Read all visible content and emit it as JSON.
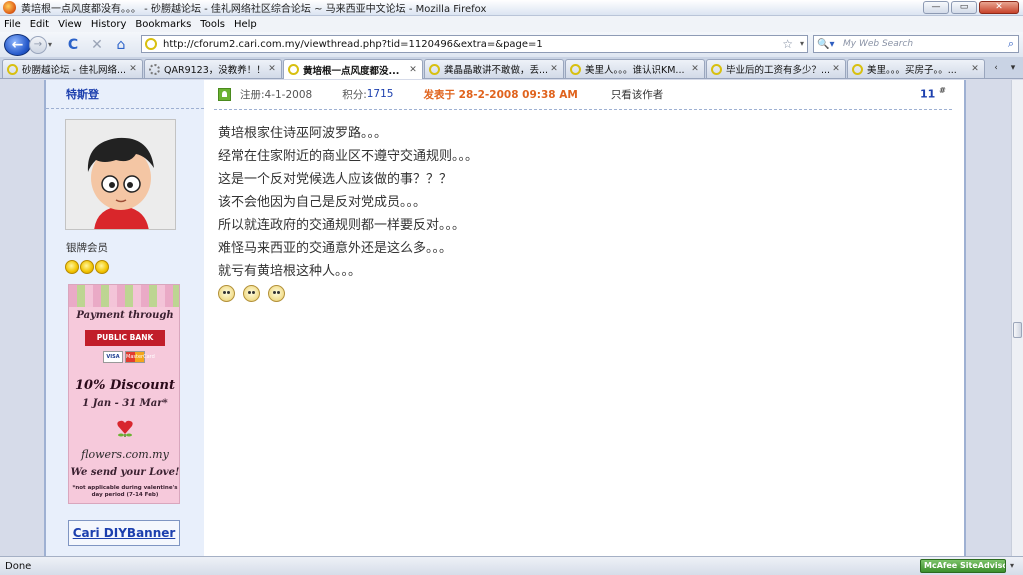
{
  "window": {
    "title": "黄培根一点风度都没有。。。 - 砂朥越论坛 - 佳礼网络社区综合论坛 ~ 马来西亚中文论坛 - Mozilla Firefox",
    "minimize": "—",
    "maximize": "▭",
    "close": "✕"
  },
  "menu": {
    "items": [
      {
        "label": "File"
      },
      {
        "label": "Edit"
      },
      {
        "label": "View"
      },
      {
        "label": "History"
      },
      {
        "label": "Bookmarks"
      },
      {
        "label": "Tools"
      },
      {
        "label": "Help"
      }
    ]
  },
  "nav": {
    "back": "←",
    "forward": "→",
    "dropdown": "▾",
    "reload": "C",
    "stop": "✕",
    "home": "⌂",
    "url": "http://cforum2.cari.com.my/viewthread.php?tid=1120496&extra=&page=1",
    "bookmark_star": "☆",
    "url_dropdown": "▾",
    "search_engine": "🔍▾",
    "search_placeholder": "My Web Search",
    "search_go": "⌕"
  },
  "tabs": [
    {
      "label": "砂朥越论坛 - 佳礼网络...",
      "close": "✕",
      "active": false,
      "loading": false
    },
    {
      "label": "QAR9123，没教养！！...",
      "close": "✕",
      "active": false,
      "loading": true
    },
    {
      "label": "黄培根一点风度都没...",
      "close": "✕",
      "active": true,
      "loading": false
    },
    {
      "label": "龚晶晶敢讲不敢做，丢...",
      "close": "✕",
      "active": false,
      "loading": false
    },
    {
      "label": "美里人。。。谁认识KM...",
      "close": "✕",
      "active": false,
      "loading": false
    },
    {
      "label": "毕业后的工资有多少？...",
      "close": "✕",
      "active": false,
      "loading": false
    },
    {
      "label": "美里。。。买房子。。...",
      "close": "✕",
      "active": false,
      "loading": false
    }
  ],
  "tab_scroll": {
    "left": "‹",
    "right": "▾"
  },
  "post": {
    "username": "特斯登",
    "rank": "银牌会员",
    "meta": {
      "registered": "注册:4-1-2008",
      "points_label": "积分:",
      "points_value": "1715",
      "posted": "发表于 28-2-2008 09:38 AM",
      "author_only": "只看该作者"
    },
    "floor": "11",
    "floor_mark": "#",
    "body_lines": [
      "黄培根家住诗巫阿波罗路。。。",
      "经常在住家附近的商业区不遵守交通规则。。。",
      "这是一个反对党候选人应该做的事？？？",
      "该不会他因为自己是反对党成员。。。",
      "所以就连政府的交通规则都一样要反对。。。",
      "难怪马来西亚的交通意外还是这么多。。。",
      "就亏有黄培根这种人。。。"
    ],
    "emote_count": 3
  },
  "ad": {
    "payment": "Payment through",
    "bank": "PUBLIC BANK",
    "visa": "VISA",
    "mastercard": "MasterCard",
    "discount": "10% Discount",
    "dates": "1 Jan - 31 Mar*",
    "site": "flowers.com.my",
    "tagline": "We send your Love!",
    "note": "*not applicable during valentine's day period (7-14 Feb)"
  },
  "diy_banner": "Cari DIYBanner",
  "status": {
    "text": "Done",
    "mcafee": "McAfee SiteAdvisor",
    "mcafee_dropdown": "▾"
  },
  "colors": {
    "link_blue": "#1c3fae",
    "posted_orange": "#e0631d",
    "left_panel": "#e8effb"
  }
}
